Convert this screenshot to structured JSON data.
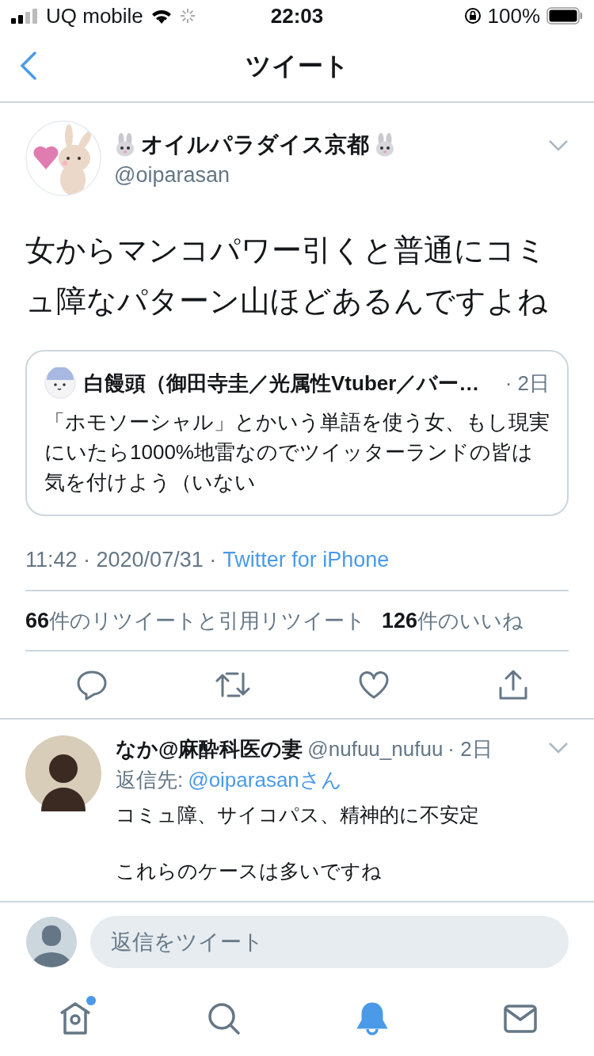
{
  "status_bar": {
    "carrier": "UQ mobile",
    "time": "22:03",
    "battery": "100%"
  },
  "nav": {
    "title": "ツイート"
  },
  "tweet": {
    "name": "オイルパラダイス京都",
    "handle": "@oiparasan",
    "text": "女からマンコパワー引くと普通にコミュ障なパターン山ほどあるんですよね",
    "quote": {
      "name": "白饅頭（御田寺圭／光属性Vtuber／バー…",
      "time": "· 2日",
      "text": "「ホモソーシャル」とかいう単語を使う女、もし現実にいたら1000%地雷なのでツイッターランドの皆は気を付けよう（いない"
    },
    "timestamp": "11:42 · 2020/07/31 ·",
    "source": "Twitter for iPhone",
    "stats": [
      "**66**件のリツイートと引用リツイート",
      "**126**件のいいね"
    ]
  },
  "reply": {
    "name": "なか@麻酔科医の妻",
    "handle": "@nufuu_nufuu",
    "time": "· 2日",
    "reply_label": "返信先:",
    "reply_to": "@oiparasanさん",
    "paragraphs": [
      "コミュ障、サイコパス、精神的に不安定",
      "これらのケースは多いですね"
    ]
  },
  "composer": {
    "placeholder": "返信をツイート"
  },
  "tabs": [
    {
      "kind": "home",
      "selected": false,
      "dot": true
    },
    {
      "kind": "search",
      "selected": false,
      "dot": false
    },
    {
      "kind": "bell",
      "selected": true,
      "dot": false
    },
    {
      "kind": "mail",
      "selected": false,
      "dot": false
    }
  ]
}
